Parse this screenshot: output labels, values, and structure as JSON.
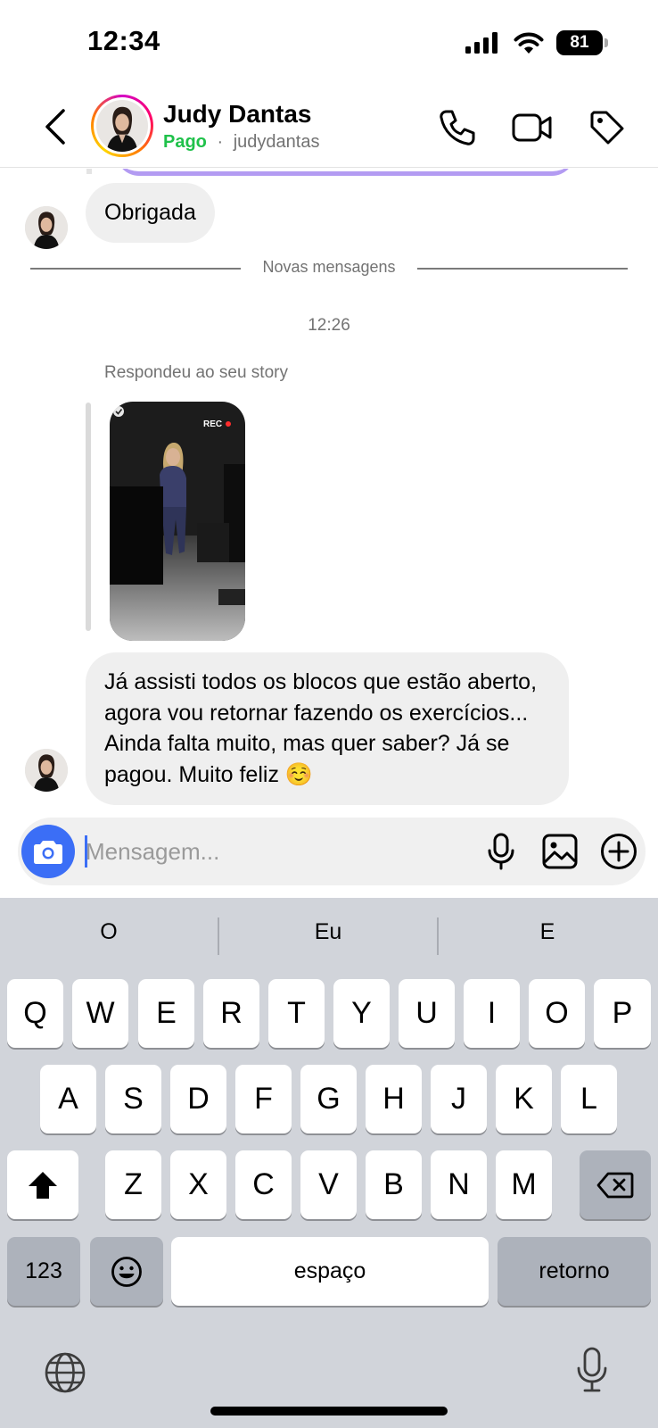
{
  "status_bar": {
    "time": "12:34",
    "battery": "81"
  },
  "header": {
    "name": "Judy Dantas",
    "status_label": "Pago",
    "separator": "·",
    "username": "judydantas"
  },
  "chat": {
    "message_1": "Obrigada",
    "divider_label": "Novas mensagens",
    "timestamp": "12:26",
    "reply_label": "Respondeu ao seu story",
    "story_rec_label": "REC",
    "message_2": "Já assisti todos os blocos que estão aberto, agora vou retornar  fazendo os exercícios... Ainda falta muito, mas quer saber? Já se pagou.  Muito feliz ☺️"
  },
  "composer": {
    "placeholder": "Mensagem..."
  },
  "keyboard": {
    "suggestions": [
      "O",
      "Eu",
      "E"
    ],
    "row1": [
      "Q",
      "W",
      "E",
      "R",
      "T",
      "Y",
      "U",
      "I",
      "O",
      "P"
    ],
    "row2": [
      "A",
      "S",
      "D",
      "F",
      "G",
      "H",
      "J",
      "K",
      "L"
    ],
    "row3": [
      "Z",
      "X",
      "C",
      "V",
      "B",
      "N",
      "M"
    ],
    "numbers_key": "123",
    "space_key": "espaço",
    "return_key": "retorno"
  },
  "colors": {
    "accent_blue": "#3b6ef6",
    "paid_green": "#1fc14a",
    "bubble_gray": "#efefef",
    "keyboard_bg": "#d1d4da"
  },
  "icons": [
    "back-icon",
    "phone-icon",
    "video-icon",
    "tag-icon",
    "camera-icon",
    "microphone-icon",
    "gallery-icon",
    "plus-icon",
    "shift-icon",
    "backspace-icon",
    "emoji-icon",
    "globe-icon",
    "dictation-icon"
  ]
}
